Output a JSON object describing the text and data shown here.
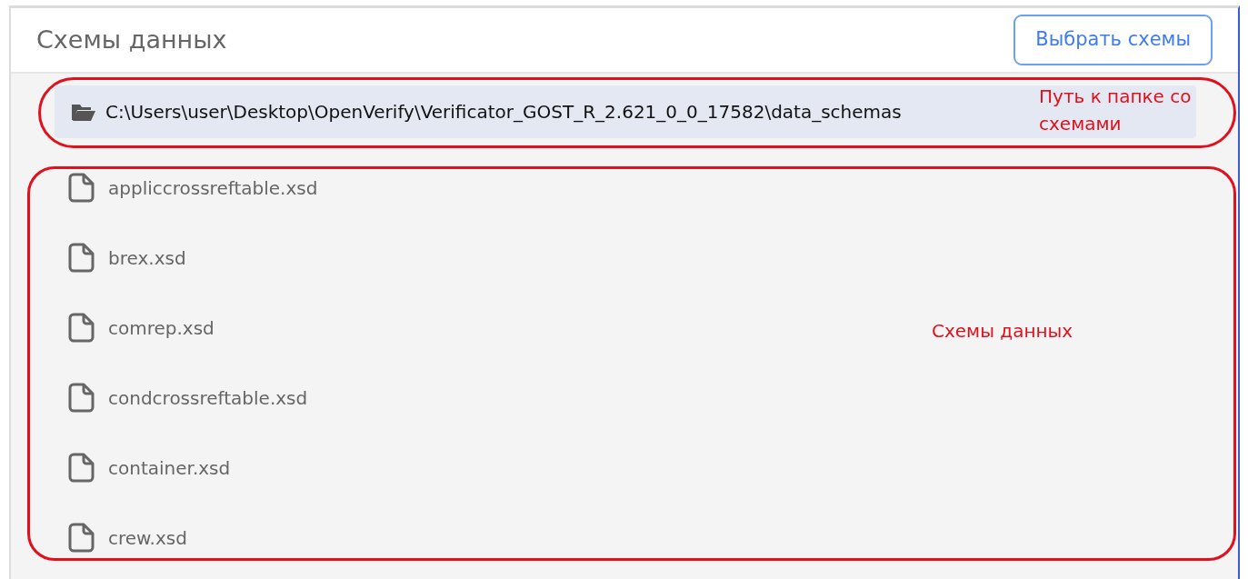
{
  "panel": {
    "title": "Схемы данных",
    "button": "Выбрать схемы"
  },
  "folder_path": "C:\\Users\\user\\Desktop\\OpenVerify\\Verificator_GOST_R_2.621_0_0_17582\\data_schemas",
  "files": [
    {
      "name": "appliccrossreftable.xsd"
    },
    {
      "name": "brex.xsd"
    },
    {
      "name": "comrep.xsd"
    },
    {
      "name": "condcrossreftable.xsd"
    },
    {
      "name": "container.xsd"
    },
    {
      "name": "crew.xsd"
    }
  ],
  "annotations": [
    {
      "kind": "path",
      "text": "Путь к папке со схемами"
    },
    {
      "kind": "files",
      "text": "Схемы данных"
    }
  ]
}
